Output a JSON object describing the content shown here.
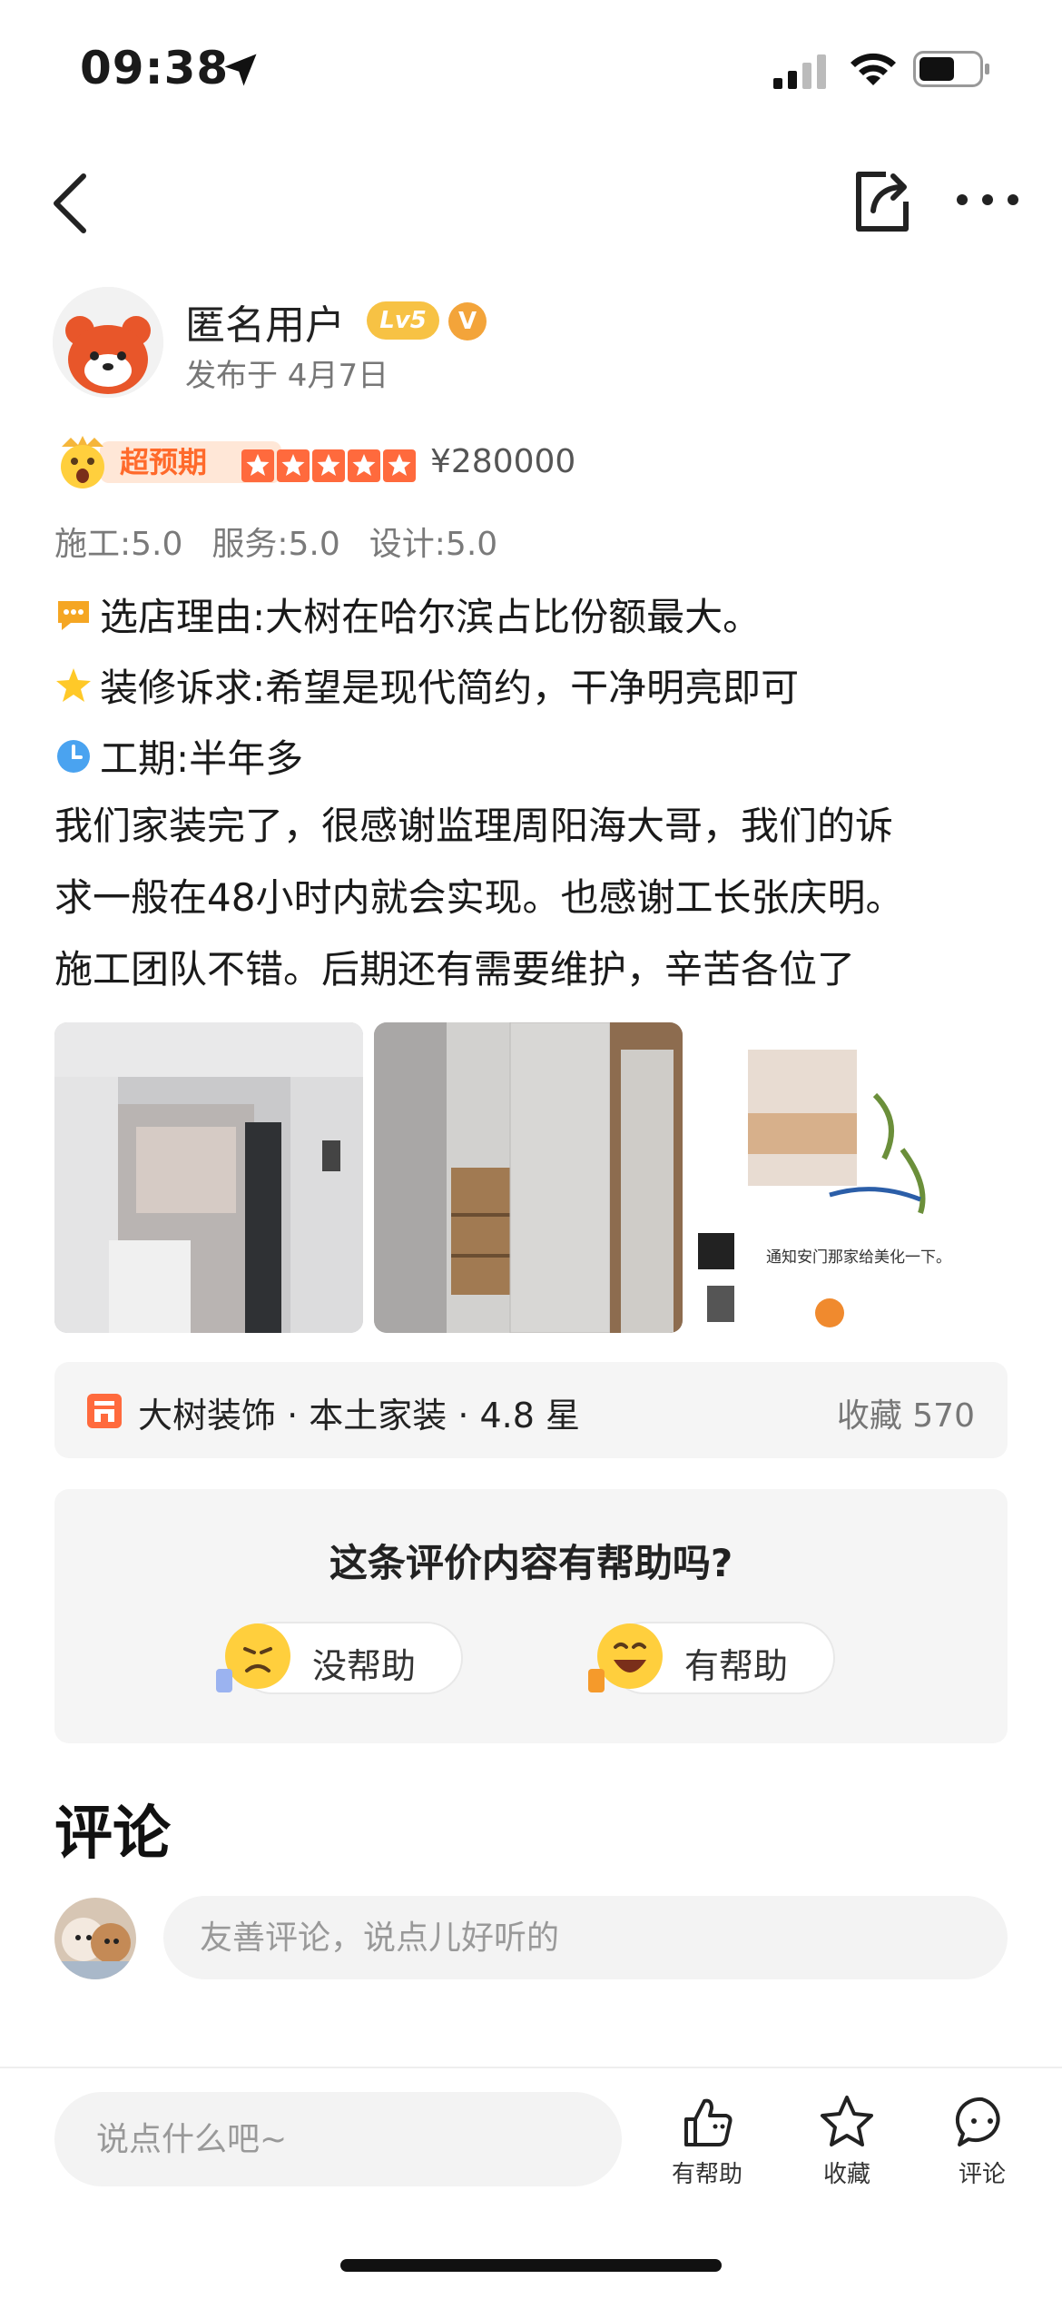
{
  "status_bar": {
    "time": "09:38"
  },
  "header": {
    "username": "匿名用户",
    "level": "Lv5",
    "verified": "V",
    "post_date": "发布于 4月7日"
  },
  "rating": {
    "exceed_label": "超预期",
    "stars": 5,
    "price": "¥280000",
    "scores": [
      "施工:5.0",
      "服务:5.0",
      "设计:5.0"
    ]
  },
  "review": {
    "reason": "选店理由:大树在哈尔滨占比份额最大。",
    "demand": "装修诉求:希望是现代简约，干净明亮即可",
    "duration": "工期:半年多",
    "lines": [
      "我们家装完了，很感谢监理周阳海大哥，我们的诉",
      "求一般在48小时内就会实现。也感谢工长张庆明。",
      "施工团队不错。后期还有需要维护，辛苦各位了"
    ]
  },
  "photos": {
    "caption3": "通知安门那家给美化一下。"
  },
  "shop": {
    "name": "大树装饰 · 本土家装 · 4.8 星",
    "favorites": "收藏 570"
  },
  "helpful": {
    "question": "这条评价内容有帮助吗?",
    "no_label": "没帮助",
    "yes_label": "有帮助"
  },
  "comments": {
    "title": "评论",
    "placeholder": "友善评论，说点儿好听的"
  },
  "bottom_bar": {
    "input_placeholder": "说点什么吧~",
    "helpful_label": "有帮助",
    "favorite_label": "收藏",
    "comment_label": "评论"
  },
  "colors": {
    "accent_orange": "#ff6a3d",
    "level_gold": "#f7c244",
    "panel_gray": "#f5f5f5"
  },
  "icons": [
    "location-arrow-icon",
    "signal-icon",
    "wifi-icon",
    "battery-icon",
    "back-chevron-icon",
    "share-icon",
    "more-dots-icon",
    "message-emoji-icon",
    "star-emoji-icon",
    "clock-emoji-icon",
    "shop-icon",
    "thumb-up-icon",
    "star-outline-icon",
    "comment-bubble-icon"
  ]
}
